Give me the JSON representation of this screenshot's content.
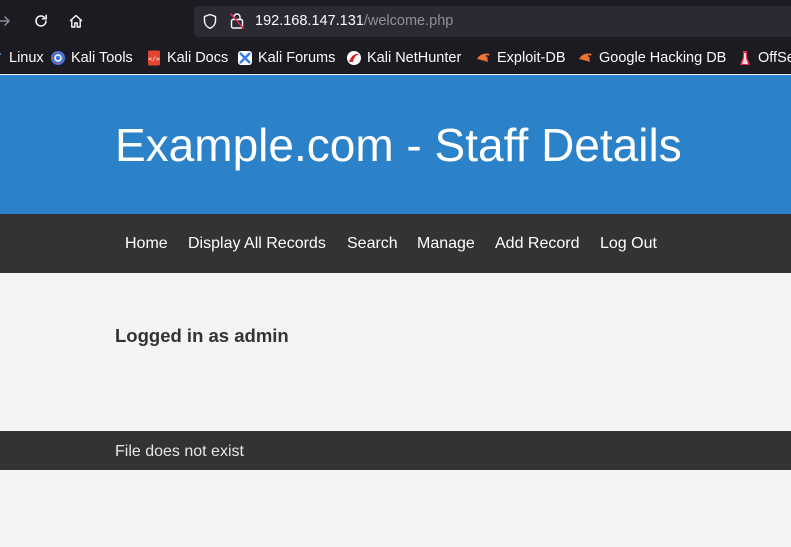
{
  "browser": {
    "address": {
      "host": "192.168.147.131",
      "path": "/welcome.php"
    },
    "bookmarks": [
      {
        "label": "Linux",
        "icon": "kali-dragon-icon"
      },
      {
        "label": "Kali Tools",
        "icon": "kali-tools-icon"
      },
      {
        "label": "Kali Docs",
        "icon": "kali-docs-icon"
      },
      {
        "label": "Kali Forums",
        "icon": "kali-forums-icon"
      },
      {
        "label": "Kali NetHunter",
        "icon": "kali-nethunter-icon"
      },
      {
        "label": "Exploit-DB",
        "icon": "exploit-db-icon"
      },
      {
        "label": "Google Hacking DB",
        "icon": "google-hacking-db-icon"
      },
      {
        "label": "OffSe",
        "icon": "offsec-icon"
      }
    ]
  },
  "page": {
    "title": "Example.com - Staff Details",
    "nav": [
      "Home",
      "Display All Records",
      "Search",
      "Manage",
      "Add Record",
      "Log Out"
    ],
    "status": "Logged in as admin",
    "footer": "File does not exist"
  },
  "colors": {
    "header_bg": "#2b82c9",
    "nav_bg": "#333333",
    "page_bg": "#f4f4f4",
    "browser_bg": "#1c1b22",
    "address_bg": "#2b2a33"
  }
}
